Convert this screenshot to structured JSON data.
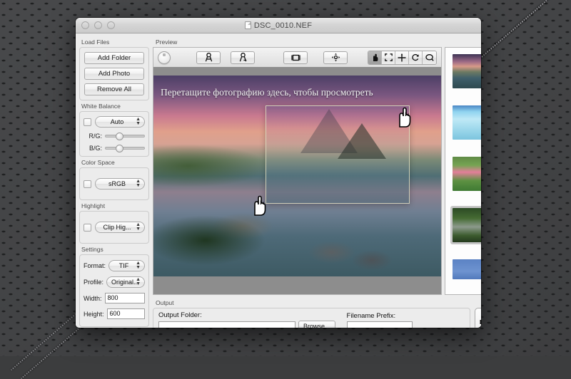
{
  "window": {
    "title": "DSC_0010.NEF",
    "title_icon": "document-icon",
    "traffic_lights": [
      "close",
      "minimize",
      "zoom"
    ]
  },
  "sidebar": {
    "load_files": {
      "label": "Load Files",
      "buttons": [
        {
          "label": "Add Folder",
          "name": "add-folder-button"
        },
        {
          "label": "Add Photo",
          "name": "add-photo-button"
        },
        {
          "label": "Remove All",
          "name": "remove-all-button"
        }
      ]
    },
    "white_balance": {
      "label": "White Balance",
      "enabled": false,
      "mode": "Auto",
      "mode_options": [
        "Auto"
      ],
      "sliders": [
        {
          "label": "R/G:",
          "value": 26
        },
        {
          "label": "B/G:",
          "value": 26
        }
      ]
    },
    "color_space": {
      "label": "Color Space",
      "enabled": false,
      "value": "sRGB",
      "options": [
        "sRGB"
      ]
    },
    "highlight": {
      "label": "Highlight",
      "enabled": false,
      "value": "Clip Hig...",
      "options": [
        "Clip Hig..."
      ]
    },
    "settings": {
      "label": "Settings",
      "fields": [
        {
          "label": "Format:",
          "value": "TIF",
          "type": "popup"
        },
        {
          "label": "Profile:",
          "value": "Original...",
          "type": "popup"
        },
        {
          "label": "Width:",
          "value": "800",
          "type": "text"
        },
        {
          "label": "Height:",
          "value": "600",
          "type": "text"
        }
      ]
    }
  },
  "preview": {
    "label": "Preview",
    "overlay_text": "Перетащите фотографию здесь, чтобы просмотреть",
    "toolbar": {
      "dial": "zoom-dial",
      "buttons": [
        {
          "name": "add-person-button",
          "icon": "person-add-icon"
        },
        {
          "name": "remove-person-button",
          "icon": "person-remove-icon"
        },
        {
          "name": "crop-button",
          "icon": "crop-icon"
        },
        {
          "name": "align-button",
          "icon": "align-icon"
        }
      ],
      "segmented": [
        {
          "name": "hand-tool",
          "icon": "hand-icon",
          "selected": true
        },
        {
          "name": "fit-screen-tool",
          "icon": "fullscreen-icon",
          "selected": false
        },
        {
          "name": "move-tool",
          "icon": "move-icon",
          "selected": false
        },
        {
          "name": "rotate-tool",
          "icon": "rotate-icon",
          "selected": false
        },
        {
          "name": "loupe-tool",
          "icon": "loupe-icon",
          "selected": false
        }
      ]
    },
    "drag_ghost": "drag-preview-thumbnail",
    "cursors": [
      "drag-hand-cursor",
      "drag-hand-cursor"
    ]
  },
  "thumbnails": {
    "items": [
      {
        "name": "thumbnail-mountain-sunset",
        "selected": false
      },
      {
        "name": "thumbnail-underwater",
        "selected": false
      },
      {
        "name": "thumbnail-lotus-flowers",
        "selected": false
      },
      {
        "name": "thumbnail-heron-nest",
        "selected": true
      },
      {
        "name": "thumbnail-blue-partial",
        "selected": false
      }
    ],
    "scrollbar": "thumbnail-scrollbar"
  },
  "output": {
    "label": "Output",
    "folder_label": "Output Folder:",
    "folder_value": "",
    "folder_placeholder": "",
    "browse_label": "Browse...",
    "prefix_label": "Filename Prefix:",
    "prefix_value": "",
    "prefix_placeholder": "",
    "export_button": "export-image-button"
  },
  "colors": {
    "window_chrome": "#ececec",
    "titlebar": "#d4d4d4",
    "canvas_bg": "#8d8d8d",
    "desktop": "#414244",
    "selection": "#c6c6c6"
  }
}
